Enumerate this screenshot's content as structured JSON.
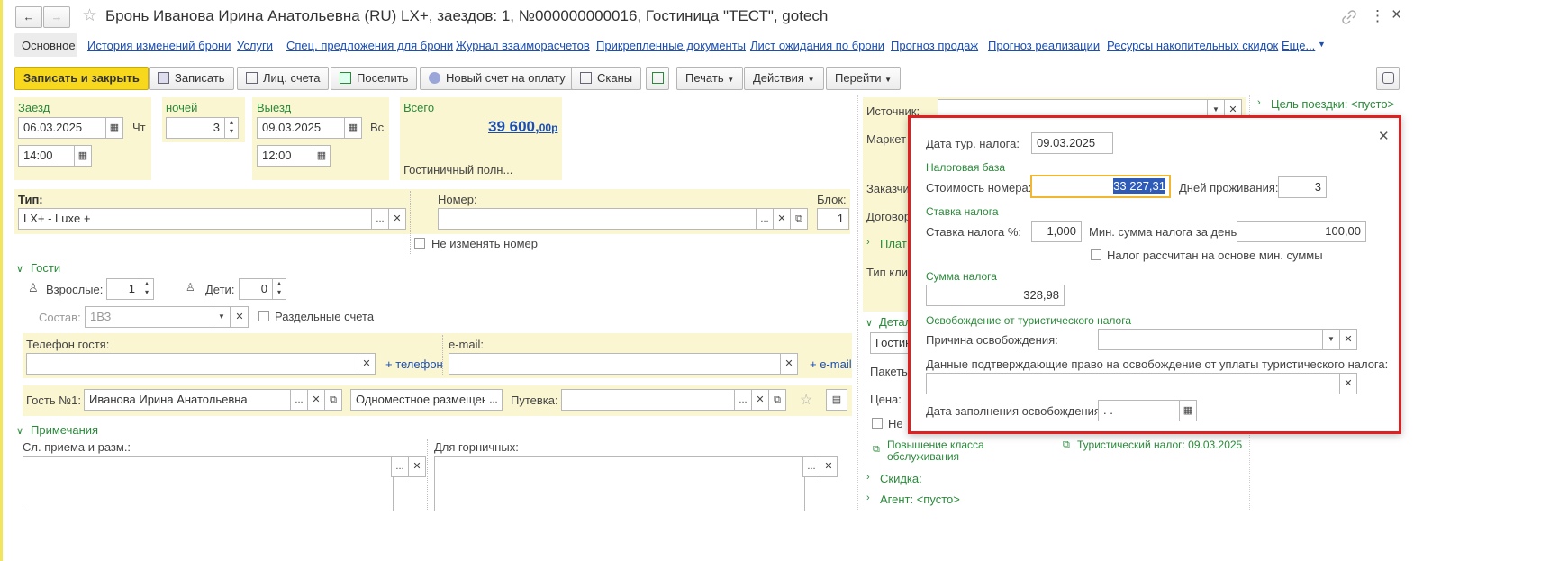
{
  "window": {
    "title": "Бронь Иванова Ирина Анатольевна (RU) LX+, заездов: 1, №000000000016, Гостиница \"ТЕСТ\", gotech",
    "back_glyph": "←",
    "forward_glyph": "→",
    "star_glyph": "☆",
    "link_glyph": "🔗",
    "more_glyph": "⋮",
    "close_glyph": "×"
  },
  "tabs": {
    "active": "Основное",
    "items": [
      "История изменений брони",
      "Услуги",
      "Спец. предложения для брони",
      "Журнал взаиморасчетов",
      "Прикрепленные документы",
      "Лист ожидания по брони",
      "Прогноз продаж",
      "Прогноз реализации",
      "Ресурсы накопительных скидок",
      "Еще..."
    ]
  },
  "toolbar": {
    "save_close": "Записать и закрыть",
    "save": "Записать",
    "accounts": "Лиц. счета",
    "checkin": "Поселить",
    "new_invoice": "Новый счет на оплату",
    "scans": "Сканы",
    "print": "Печать",
    "actions": "Действия",
    "goto": "Перейти"
  },
  "booking": {
    "checkin_label": "Заезд",
    "checkin_date": "06.03.2025",
    "checkin_day": "Чт",
    "checkin_time": "14:00",
    "nights_label": "ночей",
    "nights": "3",
    "checkout_label": "Выезд",
    "checkout_date": "09.03.2025",
    "checkout_day": "Вс",
    "checkout_time": "12:00",
    "total_label": "Всего",
    "total_main": "39 600,",
    "total_kop": "00",
    "total_cur": "р",
    "total_note": "Гостиничный полн...",
    "type_label": "Тип:",
    "type_value": "LX+ - Luxe +",
    "room_label": "Номер:",
    "room_value": "",
    "block_label": "Блок:",
    "block_value": "1",
    "no_change_room": "Не изменять номер"
  },
  "guests": {
    "section": "Гости",
    "adults_label": "Взрослые:",
    "adults": "1",
    "children_label": "Дети:",
    "children": "0",
    "composition_label": "Состав:",
    "composition": "1ВЗ",
    "separate_accounts": "Раздельные счета",
    "phone_label": "Телефон гостя:",
    "add_phone": "+ телефон",
    "email_label": "e-mail:",
    "add_email": "+ e-mail",
    "guest1_label": "Гость №1:",
    "guest1_name": "Иванова Ирина Анатольевна",
    "guest1_accom": "Одноместное размещени",
    "voucher_label": "Путевка:"
  },
  "notes": {
    "section": "Примечания",
    "reception_label": "Сл. приема и разм.:",
    "housekeeping_label": "Для горничных:"
  },
  "right_panel": {
    "purpose": "Цель поездки: <пусто>",
    "source_label": "Источник:",
    "market_label": "Маркет",
    "customer_label": "Заказчи",
    "contract_label": "Договор",
    "payment_label": "Плат",
    "client_type_label": "Тип кли",
    "details_label": "Детал",
    "hotel_field": "Гостин",
    "package_label": "Пакеты",
    "price_label": "Цена:",
    "no_label": "Не",
    "upgrade_line1": "Повышение класса",
    "upgrade_line2": "обслуживания",
    "tourist_tax_link": "Туристический налог: 09.03.2025",
    "discount": "Скидка:",
    "agent": "Агент: <пусто>"
  },
  "popup": {
    "tax_date_label": "Дата тур. налога:",
    "tax_date": "09.03.2025",
    "base_section": "Налоговая база",
    "room_cost_label": "Стоимость номера:",
    "room_cost": "33 227,31",
    "days_label": "Дней проживания:",
    "days": "3",
    "rate_section": "Ставка налога",
    "rate_label": "Ставка налога %:",
    "rate": "1,000",
    "min_sum_label": "Мин. сумма налога за день:",
    "min_sum": "100,00",
    "min_based": "Налог рассчитан на основе мин. суммы",
    "sum_section": "Сумма налога",
    "sum": "328,98",
    "exempt_section": "Освобождение от туристического налога",
    "reason_label": "Причина освобождения:",
    "proof_label": "Данные подтверждающие право на освобождение от уплаты туристического налога:",
    "fill_date_label": "Дата заполнения освобождения:",
    "fill_date": " .  ."
  },
  "colors": {
    "accent_green": "#2a8a3a",
    "link_blue": "#1a4fb5",
    "highlight_red": "#e02020",
    "primary_yellow": "#f7d81c",
    "panel_yellow": "#fbf6d2"
  }
}
